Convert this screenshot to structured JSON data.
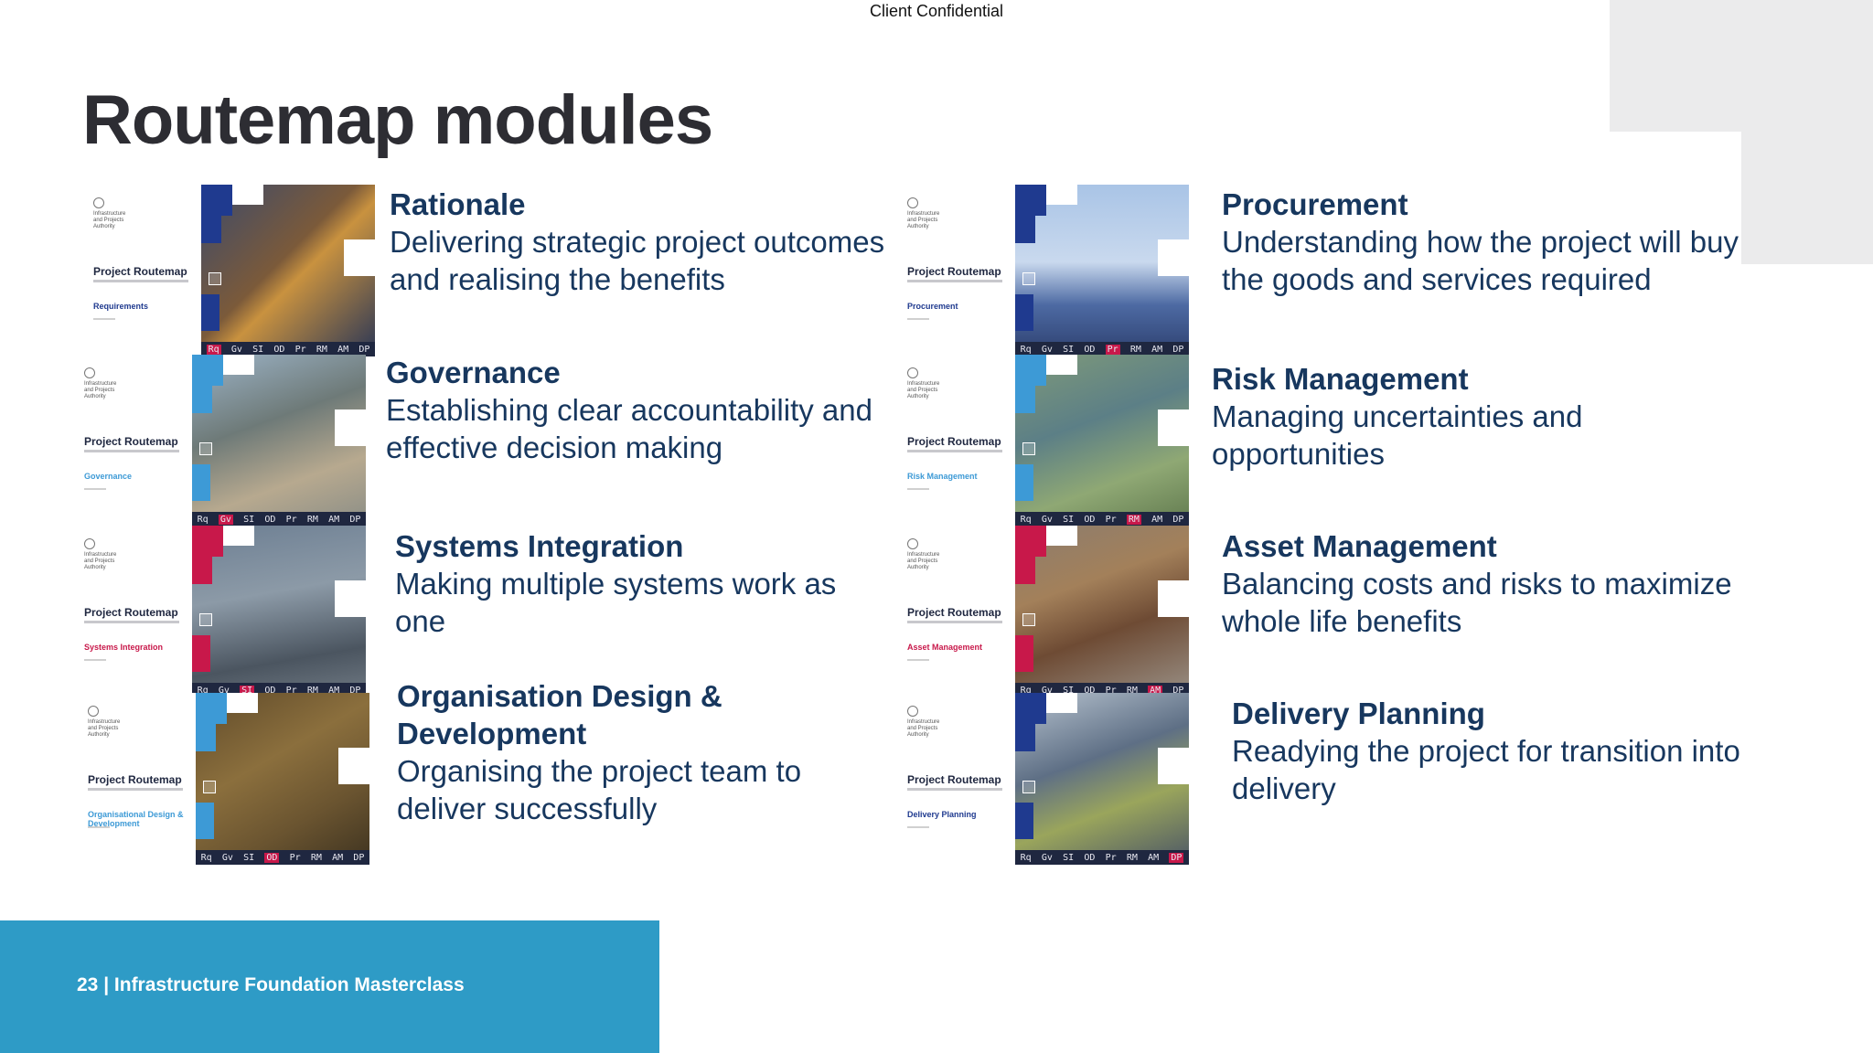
{
  "header": {
    "confidential": "Client Confidential"
  },
  "title": "Routemap modules",
  "cover_common": {
    "project_title": "Project Routemap",
    "org_lines": [
      "Infrastructure",
      "and Projects",
      "Authority"
    ],
    "strip_labels": [
      "Rq",
      "Gv",
      "SI",
      "OD",
      "Pr",
      "RM",
      "AM",
      "DP"
    ]
  },
  "modules": [
    {
      "title": "Rationale",
      "description": "Delivering strategic project outcomes and realising the benefits",
      "cover_module": "Requirements",
      "accent": "#1f3a8f"
    },
    {
      "title": "Governance",
      "description": "Establishing clear accountability and effective decision making",
      "cover_module": "Governance",
      "accent": "#3d9ad6"
    },
    {
      "title": "Systems Integration",
      "description": "Making multiple systems work as one",
      "cover_module": "Systems Integration",
      "accent": "#c8184a"
    },
    {
      "title": "Organisation Design & Development",
      "description": "Organising the project team to deliver successfully",
      "cover_module": "Organisational Design & Development",
      "accent": "#3d9ad6"
    },
    {
      "title": "Procurement",
      "description": "Understanding how the project will buy the goods and services required",
      "cover_module": "Procurement",
      "accent": "#1f3a8f"
    },
    {
      "title": "Risk Management",
      "description": "Managing uncertainties and opportunities",
      "cover_module": "Risk Management",
      "accent": "#3d9ad6"
    },
    {
      "title": "Asset Management",
      "description": "Balancing costs and risks to maximize whole life benefits",
      "cover_module": "Asset Management",
      "accent": "#c8184a"
    },
    {
      "title": "Delivery Planning",
      "description": "Readying the project for transition into delivery",
      "cover_module": "Delivery Planning",
      "accent": "#1f3a8f"
    }
  ],
  "footer": {
    "text": "23 |  Infrastructure Foundation Masterclass"
  },
  "colors": {
    "title": "#2d2d33",
    "module_text": "#17375e",
    "footer_band": "#2e9bc6",
    "deco": "#ebebec"
  }
}
